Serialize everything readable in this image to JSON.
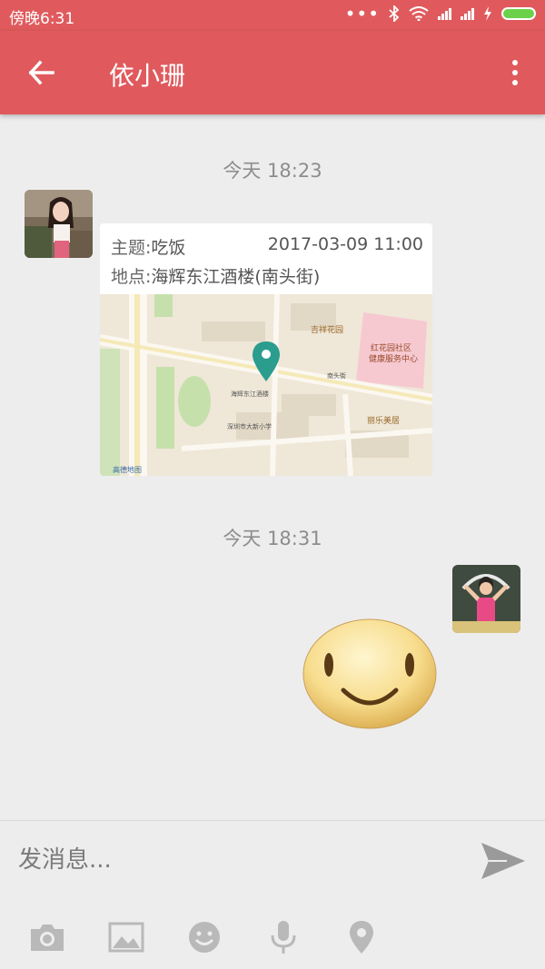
{
  "status_bar": {
    "time": "傍晚6:31"
  },
  "header": {
    "title": "依小珊"
  },
  "messages": {
    "ts1": "今天 18:23",
    "location": {
      "subject_label": "主题:",
      "subject": "吃饭",
      "datetime": "2017-03-09 11:00",
      "place_label": "地点:",
      "place": "海辉东江酒楼(南头街)"
    },
    "ts2": "今天 18:31"
  },
  "map_labels": {
    "jixiang": "吉祥花园",
    "hongyuan": "红花园社区",
    "health": "健康服务中心",
    "hotel": "海辉东江酒楼",
    "lile": "丽乐美居",
    "school": "深圳市大新小学",
    "nantou": "南头街",
    "amap": "高德地图"
  },
  "composer": {
    "placeholder": "发消息..."
  },
  "colors": {
    "brand": "#e05a5d",
    "map_pin": "#2a9d8f"
  }
}
